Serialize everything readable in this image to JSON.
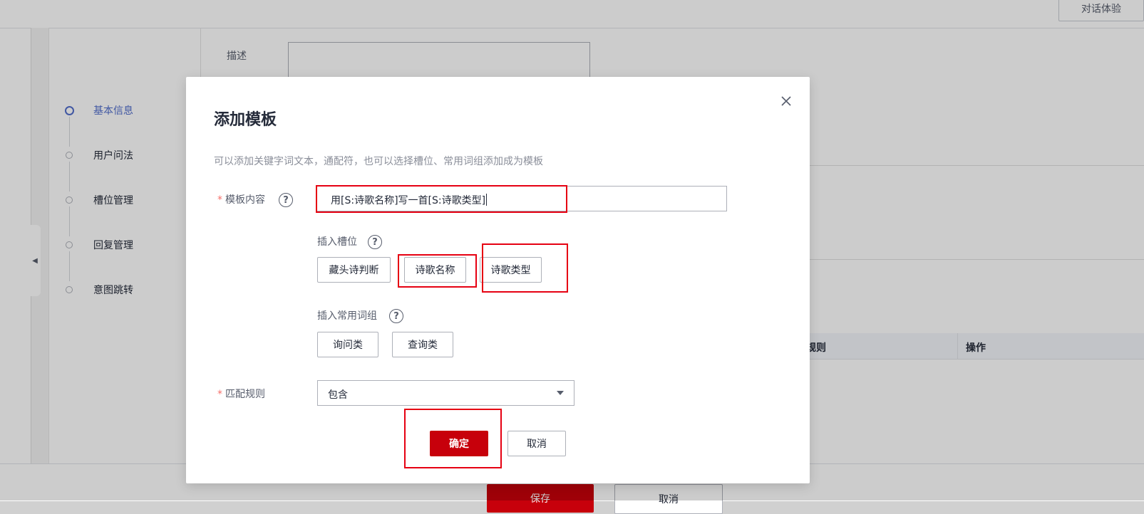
{
  "background": {
    "top_button": "对话体验",
    "steps": [
      {
        "label": "基本信息",
        "active": true
      },
      {
        "label": "用户问法",
        "active": false
      },
      {
        "label": "槽位管理",
        "active": false
      },
      {
        "label": "回复管理",
        "active": false
      },
      {
        "label": "意图跳转",
        "active": false
      }
    ],
    "description_label": "描述",
    "table_headers": [
      "规则",
      "操作"
    ],
    "save_button": "保存",
    "cancel_button": "取消"
  },
  "modal": {
    "title": "添加模板",
    "hint": "可以添加关键字词文本，通配符，也可以选择槽位、常用词组添加成为模板",
    "template_content": {
      "label": "模板内容",
      "help_icon": "?",
      "value": "用[S:诗歌名称]写一首[S:诗歌类型]"
    },
    "insert_slot": {
      "label": "插入槽位",
      "help_icon": "?",
      "options": [
        "藏头诗判断",
        "诗歌名称",
        "诗歌类型"
      ]
    },
    "insert_phrase": {
      "label": "插入常用词组",
      "help_icon": "?",
      "options": [
        "询问类",
        "查询类"
      ]
    },
    "match_rule": {
      "label": "匹配规则",
      "value": "包含"
    },
    "confirm_button": "确定",
    "cancel_button": "取消"
  },
  "colors": {
    "primary": "#c7000b",
    "active_step": "#526ecc",
    "annotation": "#e60012",
    "required_mark": "#f66f6a"
  }
}
